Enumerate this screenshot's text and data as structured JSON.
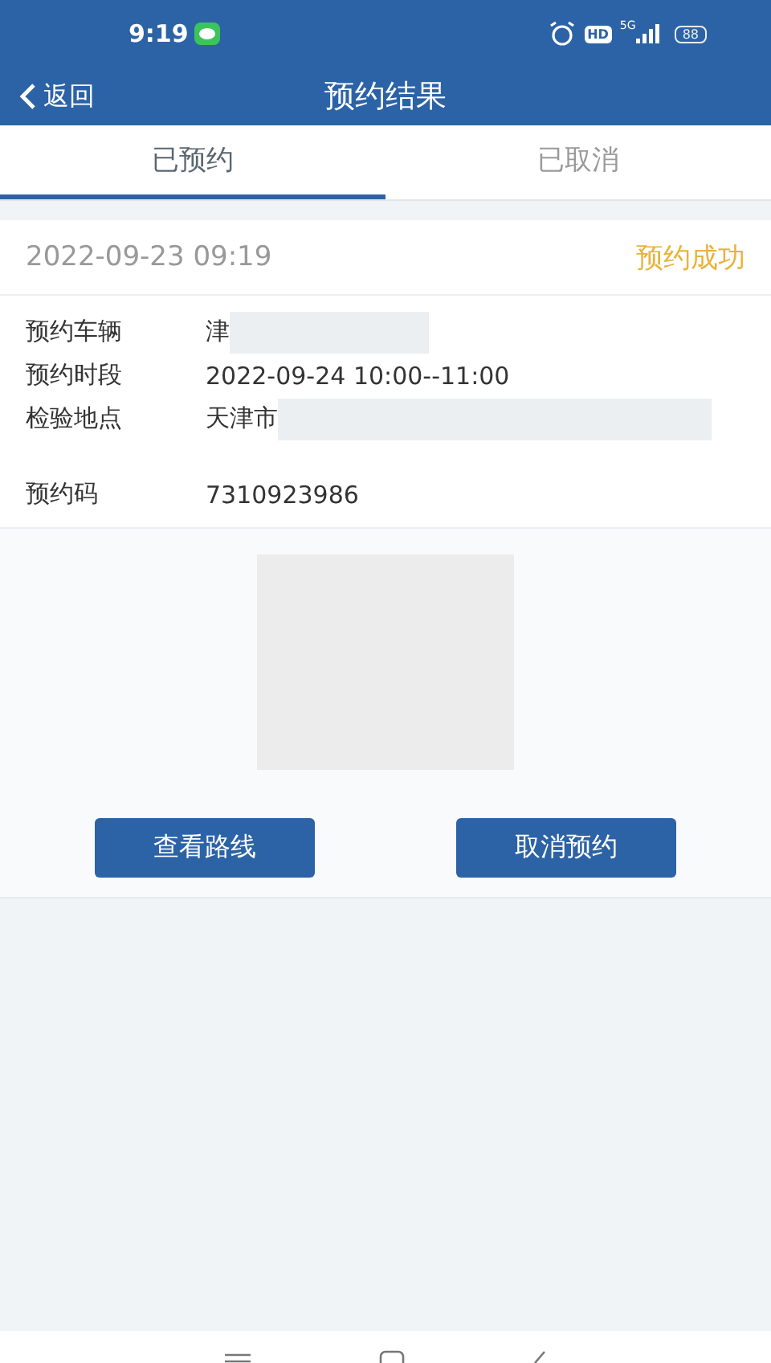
{
  "status_bar": {
    "time": "9:19",
    "hd": "HD",
    "network": "5G",
    "battery": "88"
  },
  "header": {
    "back": "返回",
    "title": "预约结果"
  },
  "tabs": [
    {
      "label": "已预约",
      "selected": true
    },
    {
      "label": "已取消",
      "selected": false
    }
  ],
  "record": {
    "created": "2022-09-23 09:19",
    "status": "预约成功",
    "fields": [
      {
        "label": "预约车辆",
        "value": "津",
        "masked": true
      },
      {
        "label": "预约时段",
        "value": "2022-09-24 10:00--11:00",
        "masked": false
      },
      {
        "label": "检验地点",
        "value": "天津市",
        "masked": true
      },
      {
        "label": "预约码",
        "value": "7310923986",
        "masked": false
      }
    ]
  },
  "buttons": [
    "查看路线",
    "取消预约"
  ]
}
